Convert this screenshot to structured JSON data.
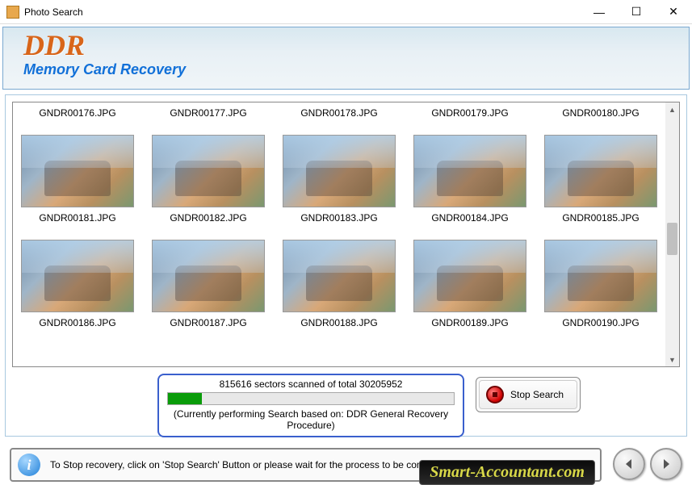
{
  "window": {
    "title": "Photo Search"
  },
  "header": {
    "logo": "DDR",
    "subtitle": "Memory Card Recovery"
  },
  "thumbs_top": [
    "GNDR00176.JPG",
    "GNDR00177.JPG",
    "GNDR00178.JPG",
    "GNDR00179.JPG",
    "GNDR00180.JPG"
  ],
  "thumbs_row2": [
    "GNDR00181.JPG",
    "GNDR00182.JPG",
    "GNDR00183.JPG",
    "GNDR00184.JPG",
    "GNDR00185.JPG"
  ],
  "thumbs_row3": [
    "GNDR00186.JPG",
    "GNDR00187.JPG",
    "GNDR00188.JPG",
    "GNDR00189.JPG",
    "GNDR00190.JPG"
  ],
  "progress": {
    "sectors_text": "815616 sectors scanned of total 30205952",
    "sub_text": "(Currently performing Search based on:  DDR General Recovery Procedure)",
    "percent": 2.7
  },
  "stop_button": "Stop Search",
  "info": {
    "text": "To Stop recovery, click on 'Stop Search' Button or please wait for the process to be completed."
  },
  "watermark": "Smart-Accountant.com"
}
